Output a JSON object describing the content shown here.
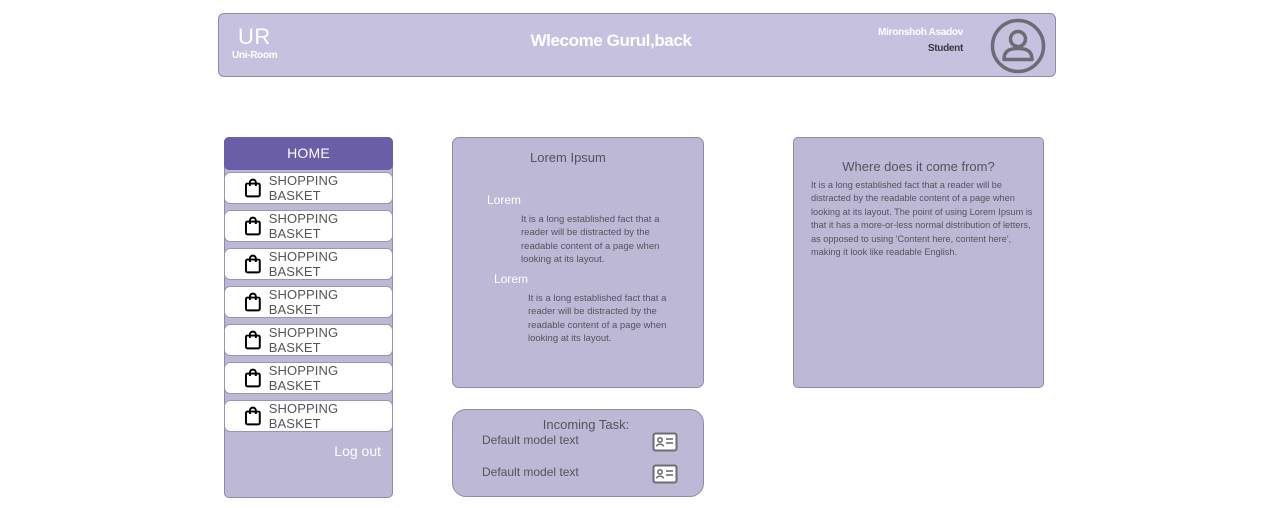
{
  "header": {
    "logo_big": "UR",
    "logo_small": "Uni-Room",
    "welcome": "Wlecome Gurul,back",
    "user_name": "Mironshoh Asadov",
    "user_role": "Student",
    "avatar_icon": "user-circle-icon"
  },
  "sidebar": {
    "home_label": "HOME",
    "items": [
      {
        "label": "SHOPPING BASKET",
        "icon": "shopping-bag-icon"
      },
      {
        "label": "SHOPPING BASKET",
        "icon": "shopping-bag-icon"
      },
      {
        "label": "SHOPPING BASKET",
        "icon": "shopping-bag-icon"
      },
      {
        "label": "SHOPPING BASKET",
        "icon": "shopping-bag-icon"
      },
      {
        "label": "SHOPPING BASKET",
        "icon": "shopping-bag-icon"
      },
      {
        "label": "SHOPPING BASKET",
        "icon": "shopping-bag-icon"
      },
      {
        "label": "SHOPPING BASKET",
        "icon": "shopping-bag-icon"
      }
    ],
    "logout_label": "Log out"
  },
  "lorem_card": {
    "title": "Lorem Ipsum",
    "sections": [
      {
        "heading": "Lorem",
        "text": "It is a long established fact that a reader will be distracted by the readable content of a page when looking at its layout."
      },
      {
        "heading": "Lorem",
        "text": "It is a long established fact that a reader will be distracted by the readable content of a page when looking at its layout."
      }
    ]
  },
  "origin_card": {
    "title": "Where does it come from?",
    "text": "It is a long established fact that a reader will be distracted by the readable content of a page when looking at its layout. The point of using Lorem Ipsum is that it has a more-or-less normal distribution of letters, as opposed to using 'Content here, content here', making it look like readable English."
  },
  "tasks_card": {
    "title": "Incoming Task:",
    "items": [
      {
        "text": "Default model text",
        "icon": "id-card-icon"
      },
      {
        "text": "Default model text",
        "icon": "id-card-icon"
      }
    ]
  },
  "colors": {
    "header_bg": "#c6c1de",
    "panel_bg": "#bcb8d6",
    "accent": "#6a5ea8"
  }
}
